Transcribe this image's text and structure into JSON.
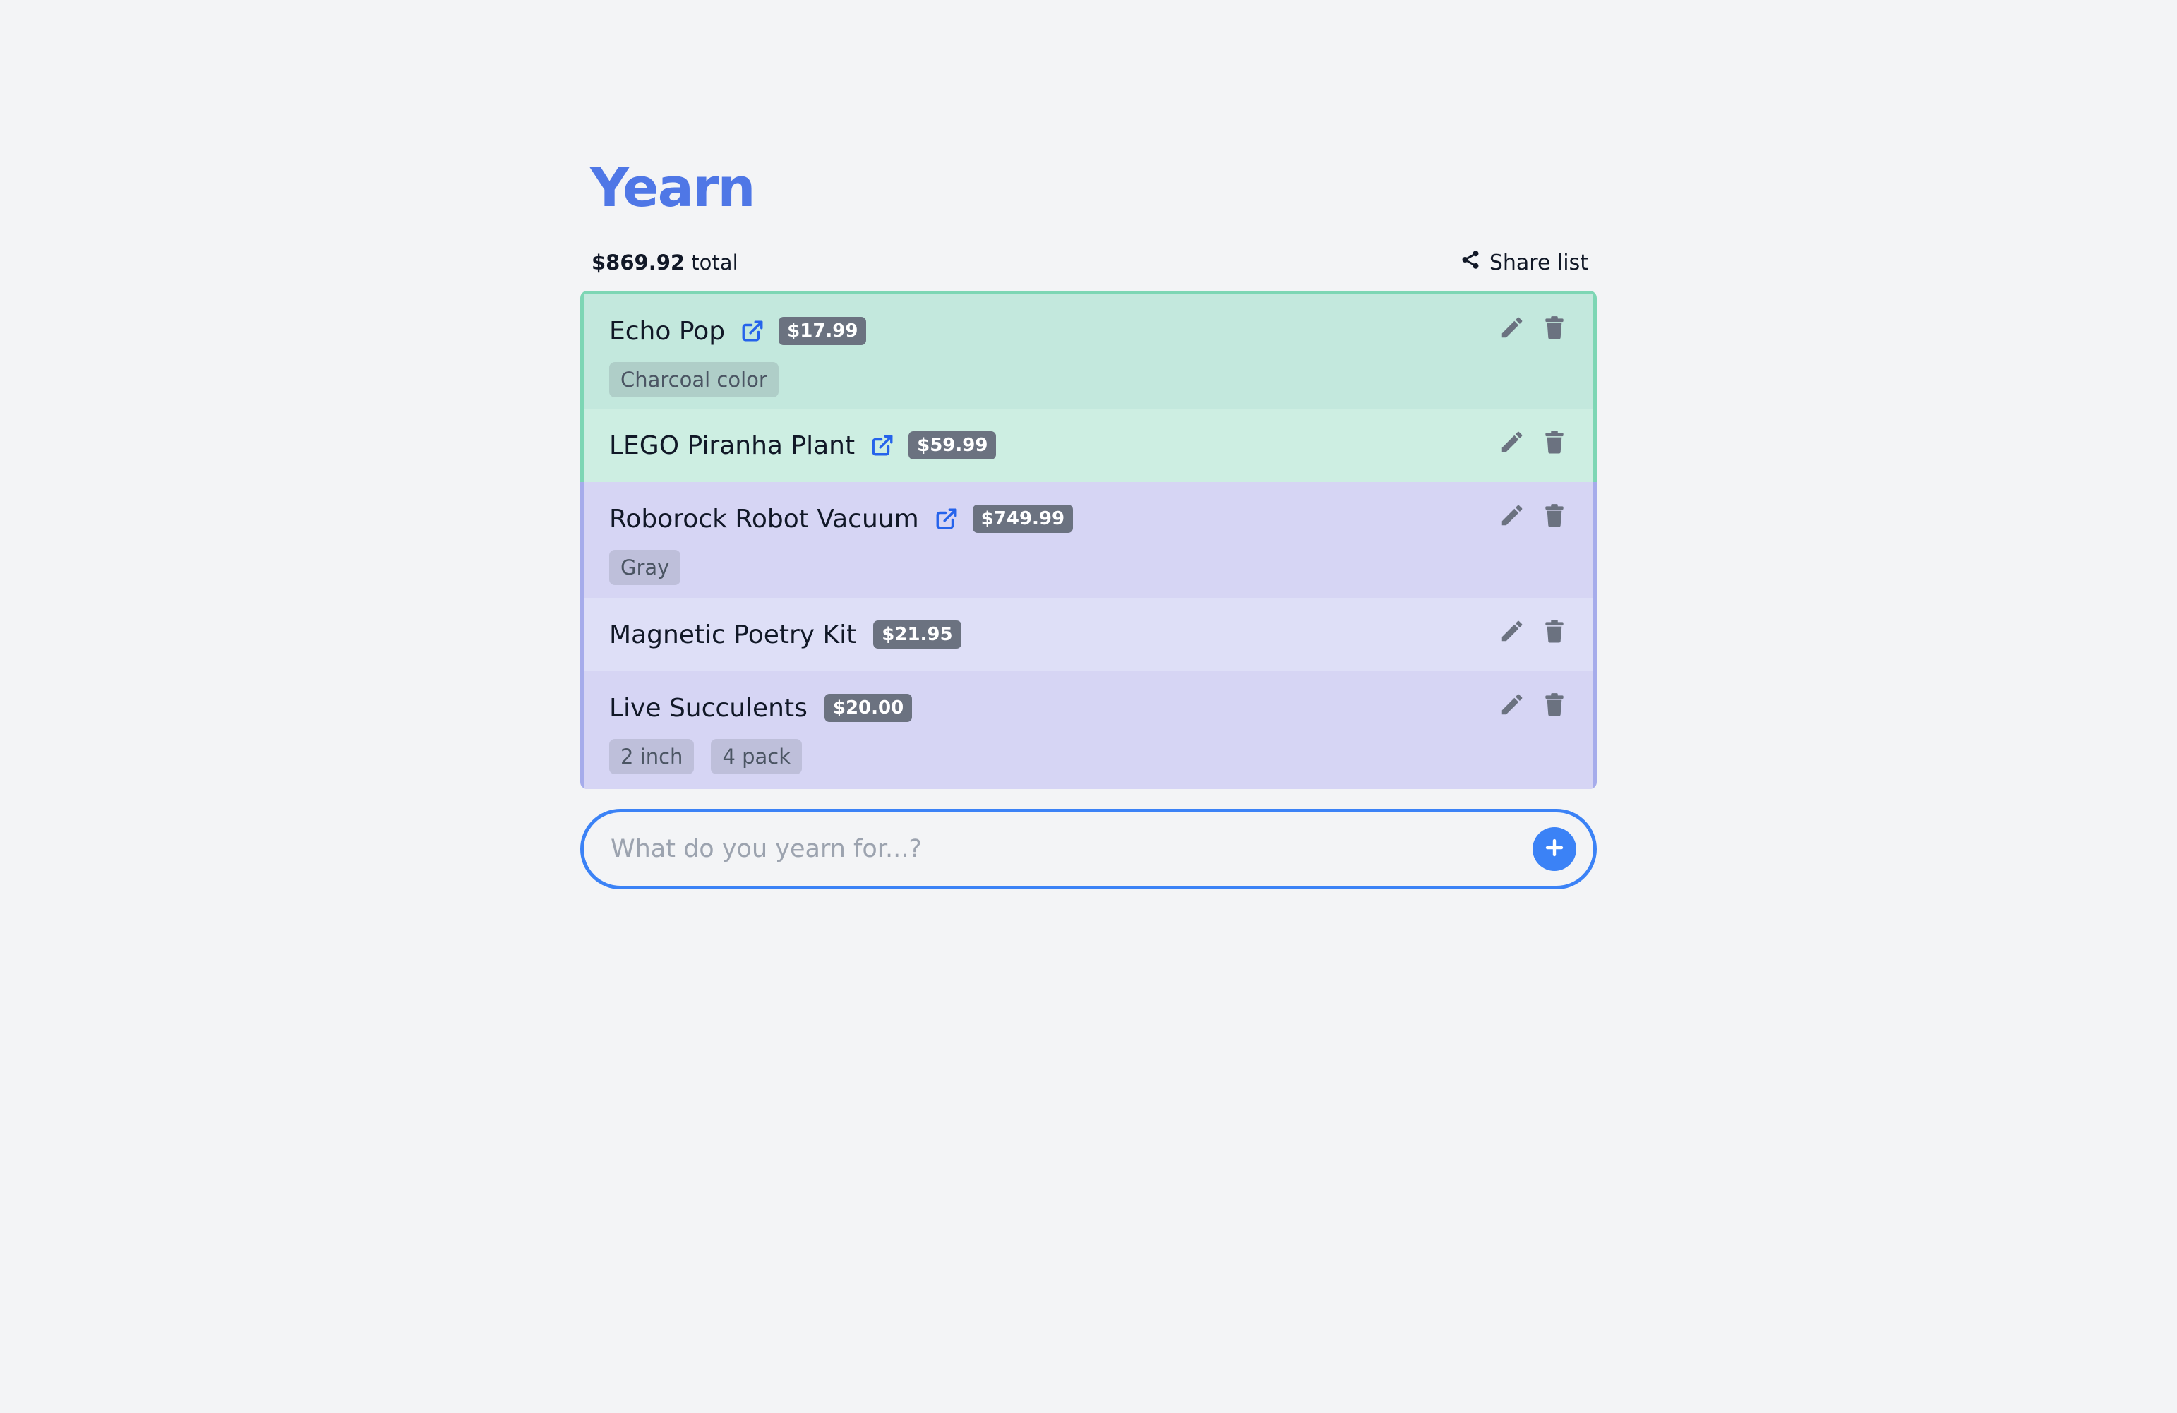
{
  "app": {
    "title": "Yearn"
  },
  "summary": {
    "total_amount": "$869.92",
    "total_suffix": " total",
    "share_label": "Share list"
  },
  "items": [
    {
      "name": "Echo Pop",
      "has_link": true,
      "price": "$17.99",
      "tags": [
        "Charcoal color"
      ]
    },
    {
      "name": "LEGO Piranha Plant",
      "has_link": true,
      "price": "$59.99",
      "tags": []
    },
    {
      "name": "Roborock Robot Vacuum",
      "has_link": true,
      "price": "$749.99",
      "tags": [
        "Gray"
      ]
    },
    {
      "name": "Magnetic Poetry Kit",
      "has_link": false,
      "price": "$21.95",
      "tags": []
    },
    {
      "name": "Live Succulents",
      "has_link": false,
      "price": "$20.00",
      "tags": [
        "2 inch",
        "4 pack"
      ]
    }
  ],
  "add_item": {
    "placeholder": "What do you yearn for...?",
    "value": ""
  },
  "colors": {
    "accent": "#3b82f6",
    "logo": "#4f77e6",
    "group_green_border": "#7dd6b4",
    "group_purple_border": "#a6aceb",
    "price_badge": "#6b7280",
    "link_icon": "#2563eb",
    "action_icon": "#6b7280"
  },
  "icons": {
    "share": "share-icon",
    "external_link": "external-link-icon",
    "edit": "pencil-icon",
    "delete": "trash-icon",
    "add": "plus-icon"
  }
}
